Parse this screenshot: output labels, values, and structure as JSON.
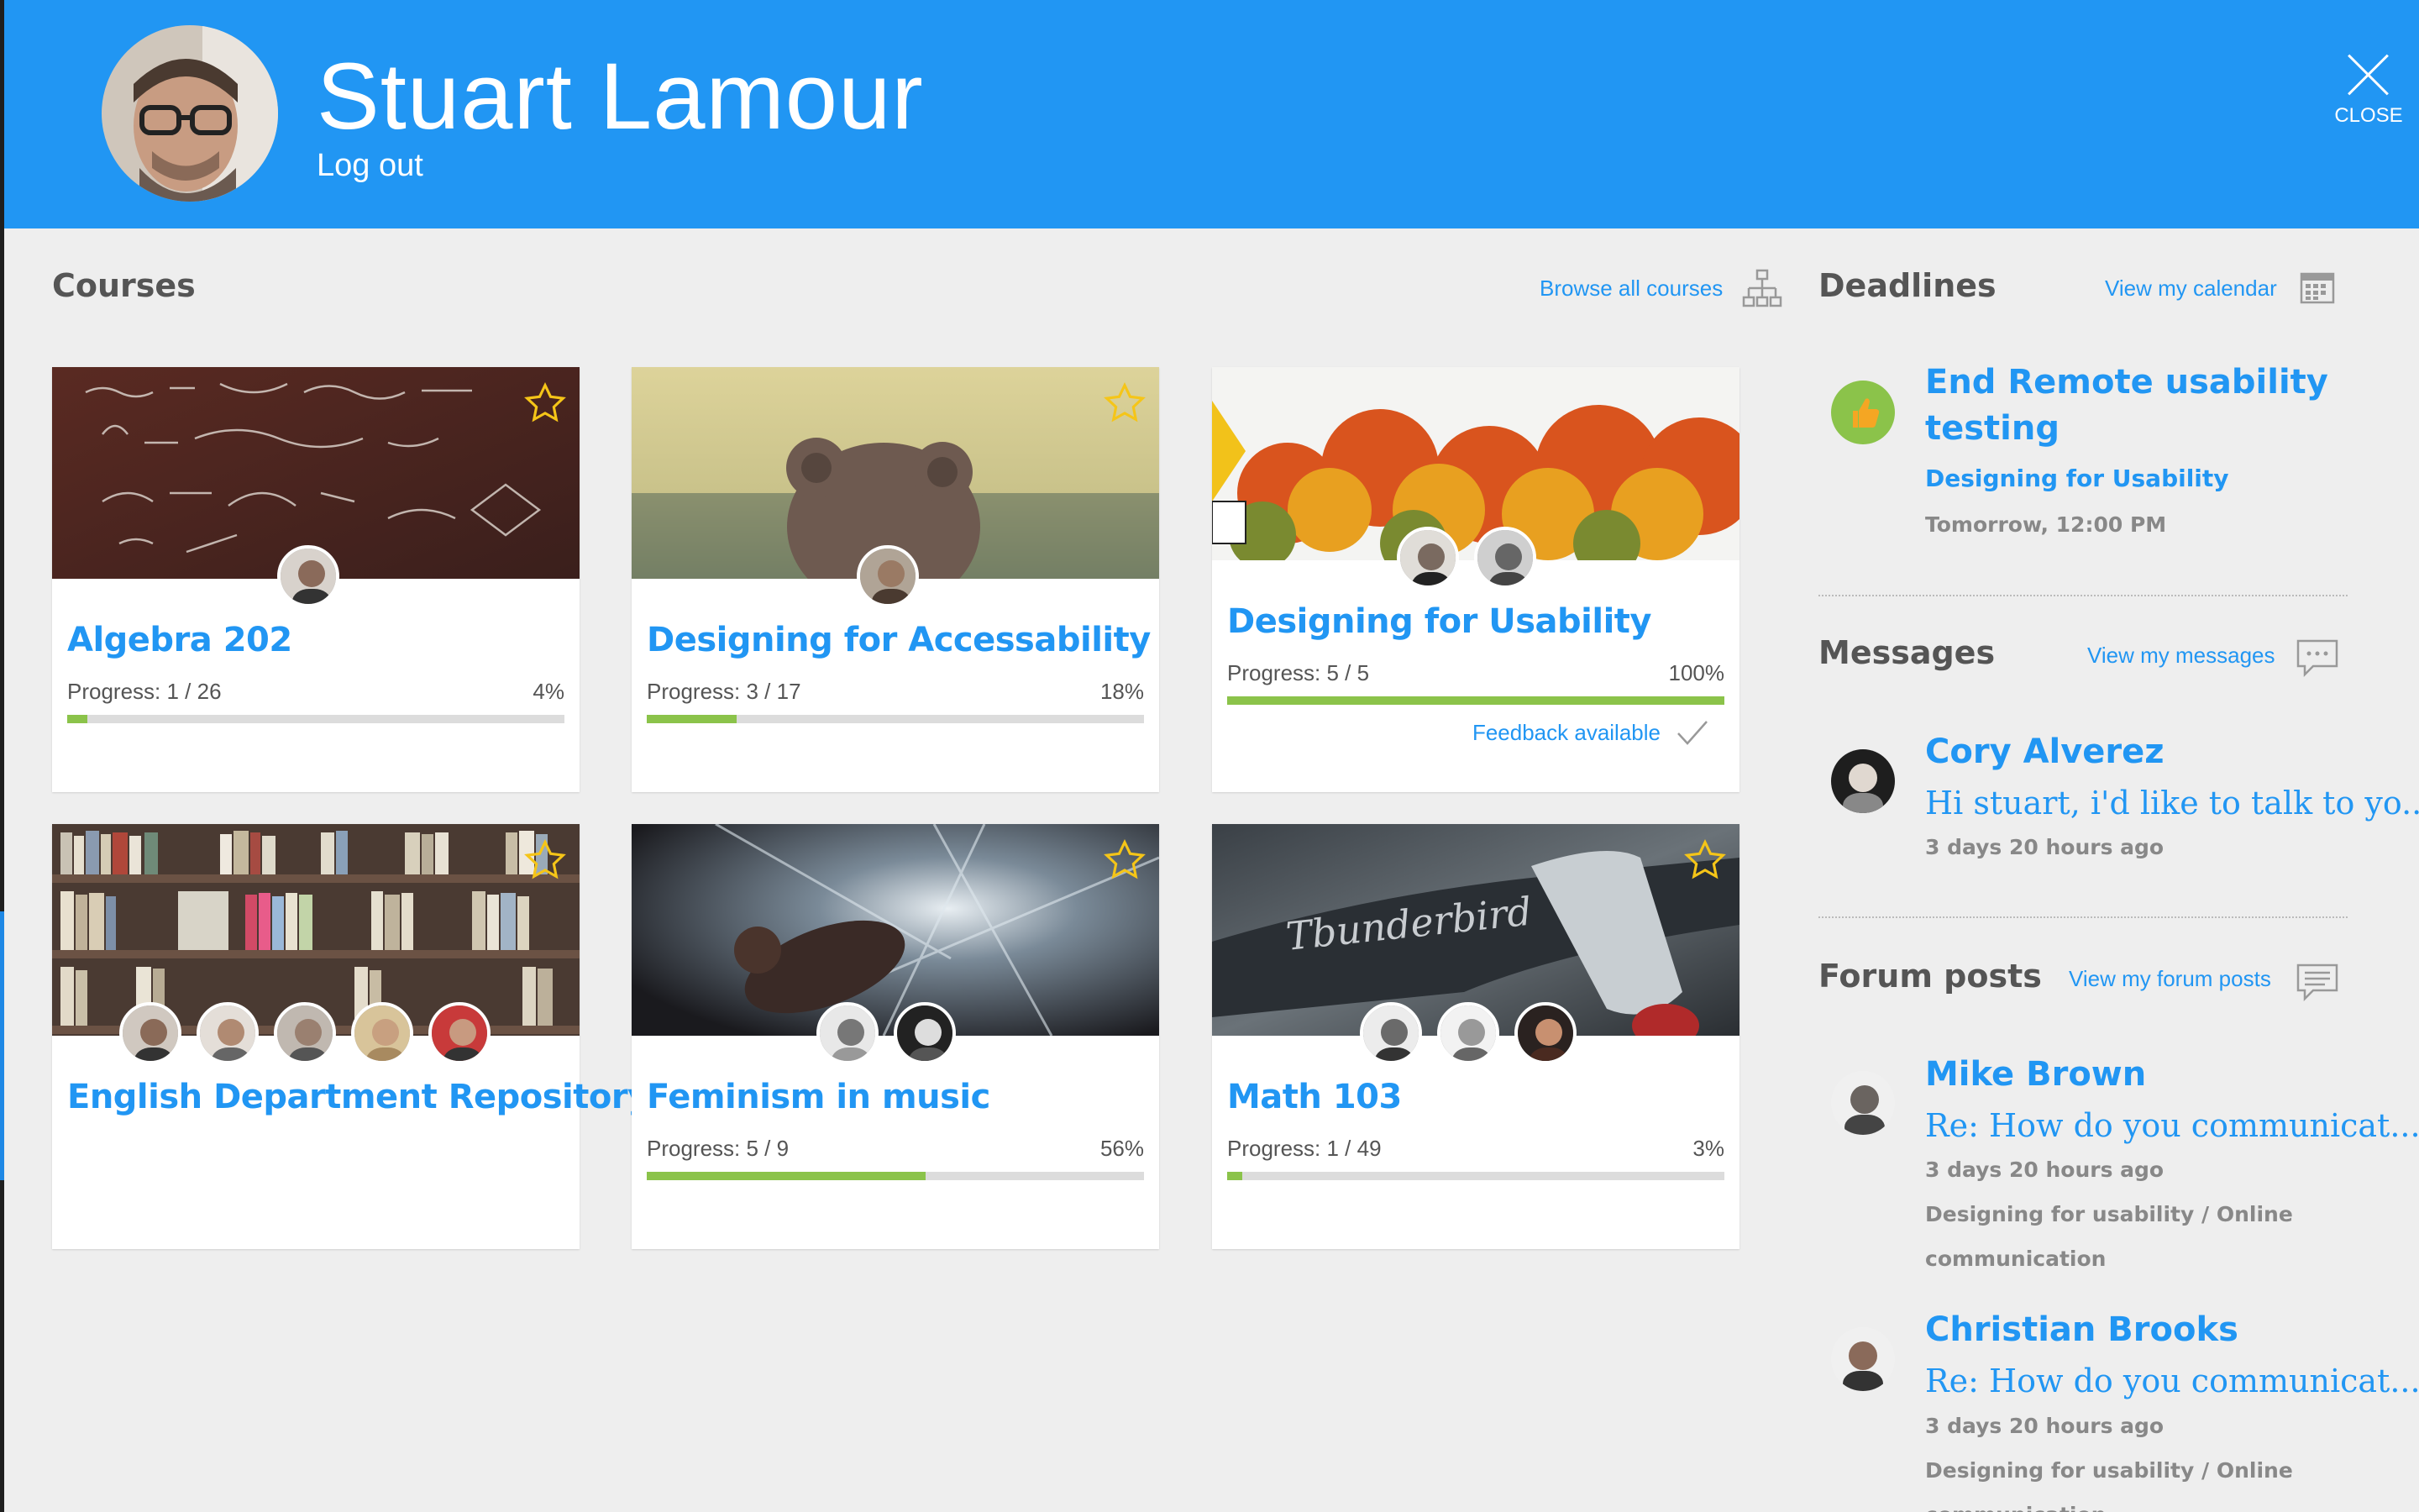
{
  "header": {
    "user_name": "Stuart Lamour",
    "logout_label": "Log out",
    "close_label": "CLOSE",
    "bg_color": "#2196f3"
  },
  "courses": {
    "heading": "Courses",
    "browse_label": "Browse all courses",
    "browse_icon": "sitemap-icon",
    "items": [
      {
        "title": "Algebra 202",
        "progress_label": "Progress: 1 / 26",
        "percent_label": "4%",
        "progress": 0.04,
        "avatars": 1,
        "starred": false
      },
      {
        "title": "Designing for Accessability",
        "progress_label": "Progress: 3 / 17",
        "percent_label": "18%",
        "progress": 0.18,
        "avatars": 1,
        "starred": false
      },
      {
        "title": "Designing for Usability",
        "progress_label": "Progress: 5 / 5",
        "percent_label": "100%",
        "progress": 1.0,
        "avatars": 2,
        "feedback": "Feedback available"
      },
      {
        "title": "English Department Repository",
        "avatars": 5,
        "starred": false
      },
      {
        "title": "Feminism in music",
        "progress_label": "Progress: 5 / 9",
        "percent_label": "56%",
        "progress": 0.56,
        "avatars": 2,
        "starred": false
      },
      {
        "title": "Math 103",
        "progress_label": "Progress: 1 / 49",
        "percent_label": "3%",
        "progress": 0.03,
        "avatars": 3,
        "starred": false
      }
    ]
  },
  "deadlines": {
    "heading": "Deadlines",
    "link_label": "View my calendar",
    "link_icon": "calendar-icon",
    "item": {
      "title_line1": "End Remote usability",
      "title_line2": "testing",
      "course": "Designing for Usability",
      "due": "Tomorrow, 12:00 PM",
      "icon": "thumbs-up-icon"
    }
  },
  "messages": {
    "heading": "Messages",
    "link_label": "View my messages",
    "link_icon": "chat-bubble-icon",
    "item": {
      "sender": "Cory Alverez",
      "preview": "Hi stuart, i'd like to talk to yo...",
      "time": "3 days 20 hours ago"
    }
  },
  "forum": {
    "heading": "Forum posts",
    "link_label": "View my forum posts",
    "link_icon": "forum-icon",
    "items": [
      {
        "author": "Mike Brown",
        "subject": "Re: How do you communicat...",
        "time": "3 days 20 hours ago",
        "context_line1": "Designing for usability / Online",
        "context_line2": "communication"
      },
      {
        "author": "Christian Brooks",
        "subject": "Re: How do you communicat...",
        "time": "3 days 20 hours ago",
        "context_line1": "Designing for usability / Online",
        "context_line2": "communication"
      }
    ]
  },
  "colors": {
    "accent": "#2196f3",
    "progress": "#8bc34a",
    "star": "#f5c518"
  }
}
